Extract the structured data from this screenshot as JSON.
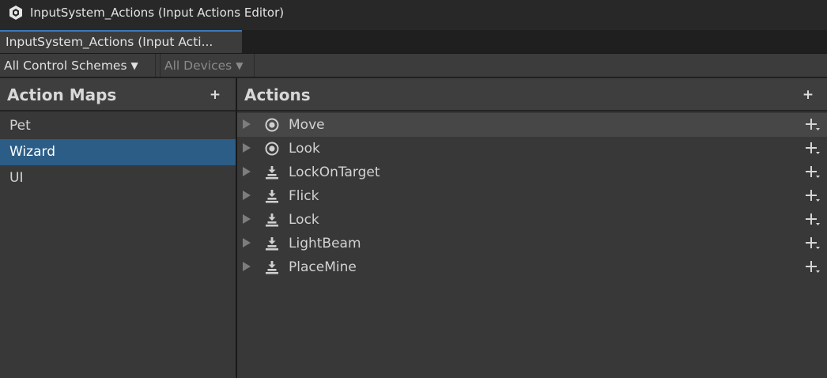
{
  "window": {
    "title": "InputSystem_Actions (Input Actions Editor)"
  },
  "tab": {
    "label": "InputSystem_Actions (Input Acti..."
  },
  "toolbar": {
    "control_schemes": "All Control Schemes",
    "devices": "All Devices"
  },
  "action_maps": {
    "title": "Action Maps",
    "add_symbol": "+",
    "items": [
      {
        "label": "Pet",
        "selected": false
      },
      {
        "label": "Wizard",
        "selected": true
      },
      {
        "label": "UI",
        "selected": false
      }
    ]
  },
  "actions": {
    "title": "Actions",
    "add_symbol": "+",
    "items": [
      {
        "label": "Move",
        "icon": "value-target-icon"
      },
      {
        "label": "Look",
        "icon": "value-target-icon"
      },
      {
        "label": "LockOnTarget",
        "icon": "button-press-icon"
      },
      {
        "label": "Flick",
        "icon": "button-press-icon"
      },
      {
        "label": "Lock",
        "icon": "button-press-icon"
      },
      {
        "label": "LightBeam",
        "icon": "button-press-icon"
      },
      {
        "label": "PlaceMine",
        "icon": "button-press-icon"
      }
    ]
  },
  "colors": {
    "selection": "#2c5d87",
    "tab_accent": "#3a79bb",
    "panel": "#383838"
  }
}
